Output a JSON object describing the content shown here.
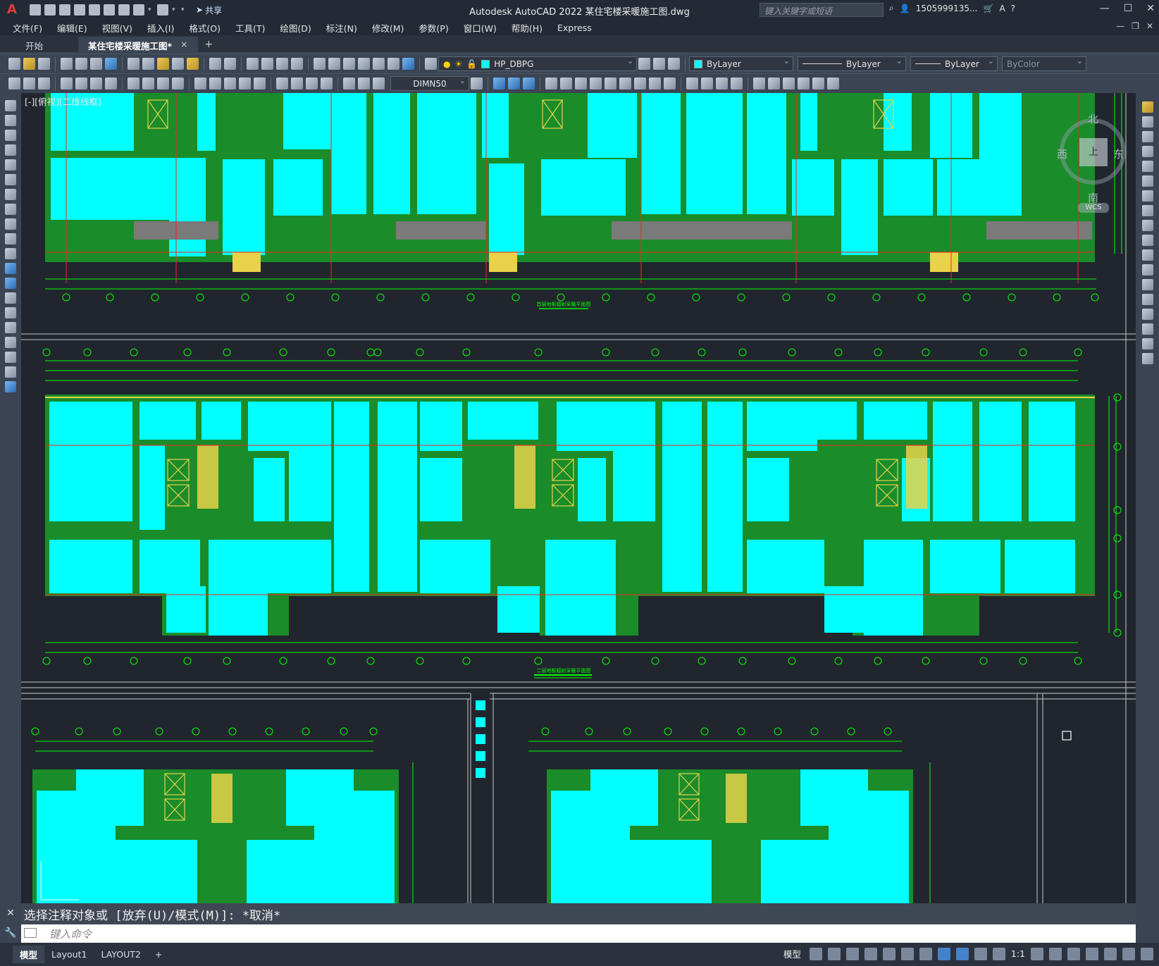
{
  "app": {
    "title": "Autodesk AutoCAD 2022    某住宅楼采暖施工图.dwg",
    "search_placeholder": "键入关键字或短语",
    "user": "1505999135...",
    "share_label": "共享"
  },
  "menu": [
    "文件(F)",
    "编辑(E)",
    "视图(V)",
    "插入(I)",
    "格式(O)",
    "工具(T)",
    "绘图(D)",
    "标注(N)",
    "修改(M)",
    "参数(P)",
    "窗口(W)",
    "帮助(H)",
    "Express"
  ],
  "tabs": {
    "start": "开始",
    "active": "某住宅楼采暖施工图*",
    "close": "×",
    "add": "+"
  },
  "properties": {
    "layer": "HP_DBPG",
    "color": "ByLayer",
    "linetype": "ByLayer",
    "lineweight": "ByLayer",
    "plotstyle": "ByColor",
    "dimstyle": "DIMN50",
    "layer_swatch": "#00ffff",
    "color_swatch": "#00ffff"
  },
  "viewport": {
    "label": "[-][俯视][二维线框]",
    "viewcube": {
      "north": "北",
      "south": "南",
      "east": "东",
      "west": "西",
      "face": "上",
      "wcs": "WCS"
    }
  },
  "drawing": {
    "plan1_title": "首层地板辐射采暖平面图",
    "plan2_title": "二层地板辐射采暖平面图"
  },
  "command": {
    "history": "选择注释对象或 [放弃(U)/模式(M)]: *取消*",
    "placeholder": "键入命令"
  },
  "layouts": [
    "模型",
    "Layout1",
    "LAYOUT2"
  ],
  "status": {
    "model": "模型",
    "scale": "1:1"
  },
  "colors": {
    "floor_heating": "#00ffff",
    "wall": "#1a8c2a",
    "grid": "#00ff00",
    "axis_red": "#ff2020",
    "stair": "#e8d24a"
  }
}
